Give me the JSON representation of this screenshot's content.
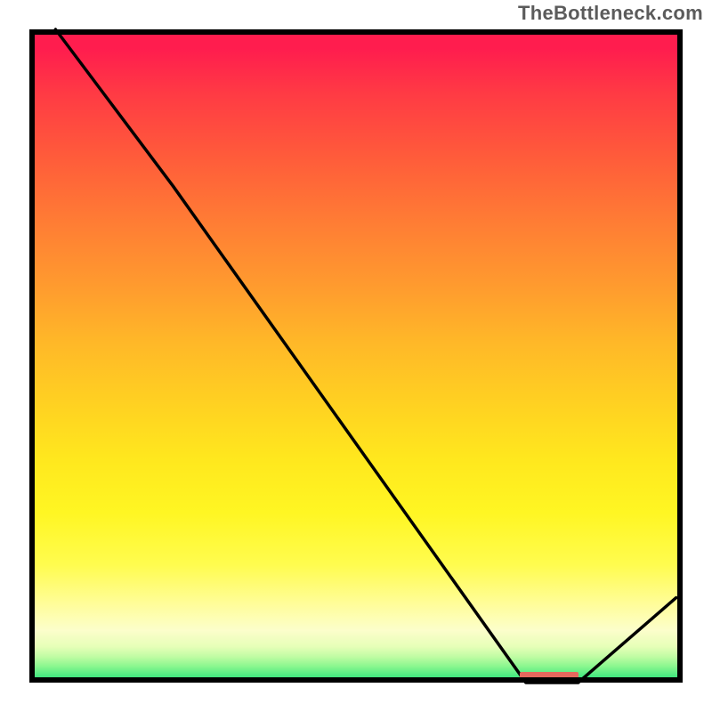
{
  "watermark": "TheBottleneck.com",
  "colors": {
    "frame": "#000000",
    "curve": "#000000",
    "marker": "#e4685d"
  },
  "chart_data": {
    "type": "line",
    "title": "",
    "xlabel": "",
    "ylabel": "",
    "xlim": [
      0,
      1
    ],
    "ylim": [
      0,
      1
    ],
    "x": [
      0.04,
      0.22,
      0.76,
      0.84,
      0.99
    ],
    "values": [
      1.0,
      0.76,
      0.0,
      0.0,
      0.13
    ],
    "marker": {
      "x_start": 0.75,
      "x_end": 0.84,
      "y": 0.0
    },
    "gradient_stops": [
      {
        "pos": 0.0,
        "color": "#ff1d4e"
      },
      {
        "pos": 0.5,
        "color": "#ffb828"
      },
      {
        "pos": 0.82,
        "color": "#fffc4f"
      },
      {
        "pos": 0.95,
        "color": "#c1fca4"
      },
      {
        "pos": 1.0,
        "color": "#1ee07a"
      }
    ]
  }
}
